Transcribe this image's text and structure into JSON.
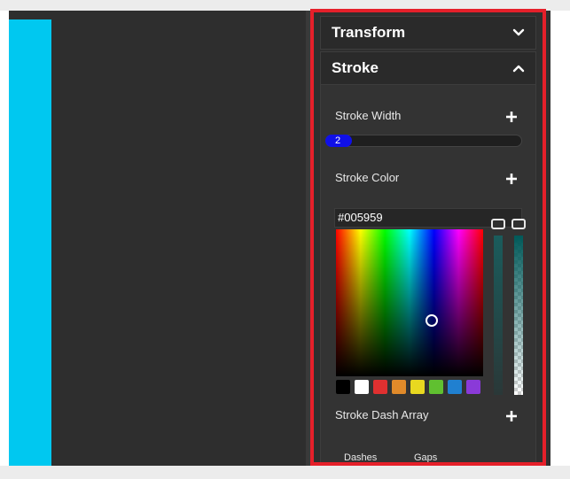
{
  "panel": {
    "sections": {
      "transform": {
        "title": "Transform",
        "expanded": false
      },
      "stroke": {
        "title": "Stroke",
        "expanded": true
      }
    },
    "stroke": {
      "width_label": "Stroke Width",
      "width_value": "2",
      "color_label": "Stroke Color",
      "color_hex": "#005959",
      "dash_label": "Stroke Dash Array",
      "dash_tabs": [
        "Dashes",
        "Gaps"
      ],
      "swatches": [
        "#000000",
        "#ffffff",
        "#e03030",
        "#e08a2a",
        "#e8d820",
        "#60c030",
        "#2080d0",
        "#8a3ad8"
      ]
    }
  },
  "colors": {
    "highlight_border": "#e5202a",
    "canvas_block": "#00c8f0",
    "slider_thumb": "#1010e8"
  },
  "icons": {
    "collapse": "chevron-down-icon",
    "expand": "chevron-up-icon",
    "add": "plus-icon"
  }
}
